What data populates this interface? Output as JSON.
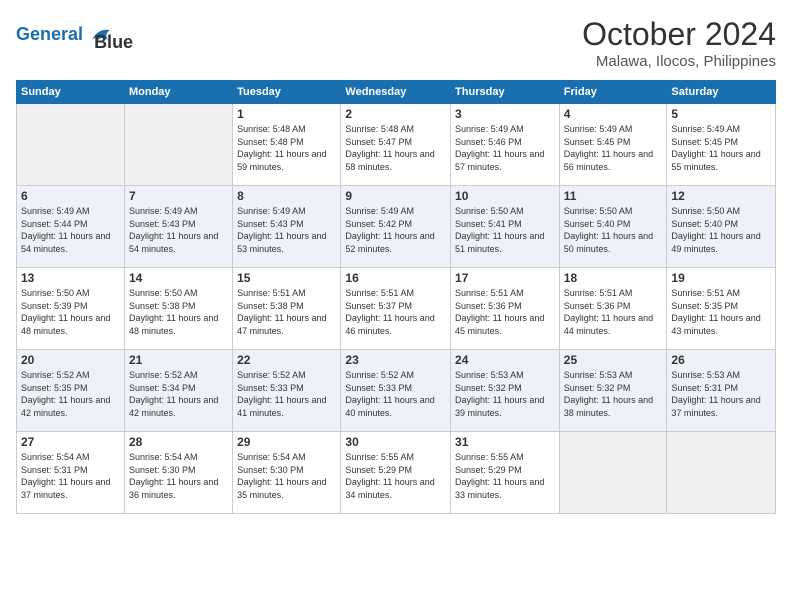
{
  "logo": {
    "line1": "General",
    "line2": "Blue"
  },
  "title": "October 2024",
  "location": "Malawa, Ilocos, Philippines",
  "weekdays": [
    "Sunday",
    "Monday",
    "Tuesday",
    "Wednesday",
    "Thursday",
    "Friday",
    "Saturday"
  ],
  "weeks": [
    [
      {
        "day": "",
        "empty": true
      },
      {
        "day": "",
        "empty": true
      },
      {
        "day": "1",
        "sunrise": "Sunrise: 5:48 AM",
        "sunset": "Sunset: 5:48 PM",
        "daylight": "Daylight: 11 hours and 59 minutes."
      },
      {
        "day": "2",
        "sunrise": "Sunrise: 5:48 AM",
        "sunset": "Sunset: 5:47 PM",
        "daylight": "Daylight: 11 hours and 58 minutes."
      },
      {
        "day": "3",
        "sunrise": "Sunrise: 5:49 AM",
        "sunset": "Sunset: 5:46 PM",
        "daylight": "Daylight: 11 hours and 57 minutes."
      },
      {
        "day": "4",
        "sunrise": "Sunrise: 5:49 AM",
        "sunset": "Sunset: 5:45 PM",
        "daylight": "Daylight: 11 hours and 56 minutes."
      },
      {
        "day": "5",
        "sunrise": "Sunrise: 5:49 AM",
        "sunset": "Sunset: 5:45 PM",
        "daylight": "Daylight: 11 hours and 55 minutes."
      }
    ],
    [
      {
        "day": "6",
        "sunrise": "Sunrise: 5:49 AM",
        "sunset": "Sunset: 5:44 PM",
        "daylight": "Daylight: 11 hours and 54 minutes."
      },
      {
        "day": "7",
        "sunrise": "Sunrise: 5:49 AM",
        "sunset": "Sunset: 5:43 PM",
        "daylight": "Daylight: 11 hours and 54 minutes."
      },
      {
        "day": "8",
        "sunrise": "Sunrise: 5:49 AM",
        "sunset": "Sunset: 5:43 PM",
        "daylight": "Daylight: 11 hours and 53 minutes."
      },
      {
        "day": "9",
        "sunrise": "Sunrise: 5:49 AM",
        "sunset": "Sunset: 5:42 PM",
        "daylight": "Daylight: 11 hours and 52 minutes."
      },
      {
        "day": "10",
        "sunrise": "Sunrise: 5:50 AM",
        "sunset": "Sunset: 5:41 PM",
        "daylight": "Daylight: 11 hours and 51 minutes."
      },
      {
        "day": "11",
        "sunrise": "Sunrise: 5:50 AM",
        "sunset": "Sunset: 5:40 PM",
        "daylight": "Daylight: 11 hours and 50 minutes."
      },
      {
        "day": "12",
        "sunrise": "Sunrise: 5:50 AM",
        "sunset": "Sunset: 5:40 PM",
        "daylight": "Daylight: 11 hours and 49 minutes."
      }
    ],
    [
      {
        "day": "13",
        "sunrise": "Sunrise: 5:50 AM",
        "sunset": "Sunset: 5:39 PM",
        "daylight": "Daylight: 11 hours and 48 minutes."
      },
      {
        "day": "14",
        "sunrise": "Sunrise: 5:50 AM",
        "sunset": "Sunset: 5:38 PM",
        "daylight": "Daylight: 11 hours and 48 minutes."
      },
      {
        "day": "15",
        "sunrise": "Sunrise: 5:51 AM",
        "sunset": "Sunset: 5:38 PM",
        "daylight": "Daylight: 11 hours and 47 minutes."
      },
      {
        "day": "16",
        "sunrise": "Sunrise: 5:51 AM",
        "sunset": "Sunset: 5:37 PM",
        "daylight": "Daylight: 11 hours and 46 minutes."
      },
      {
        "day": "17",
        "sunrise": "Sunrise: 5:51 AM",
        "sunset": "Sunset: 5:36 PM",
        "daylight": "Daylight: 11 hours and 45 minutes."
      },
      {
        "day": "18",
        "sunrise": "Sunrise: 5:51 AM",
        "sunset": "Sunset: 5:36 PM",
        "daylight": "Daylight: 11 hours and 44 minutes."
      },
      {
        "day": "19",
        "sunrise": "Sunrise: 5:51 AM",
        "sunset": "Sunset: 5:35 PM",
        "daylight": "Daylight: 11 hours and 43 minutes."
      }
    ],
    [
      {
        "day": "20",
        "sunrise": "Sunrise: 5:52 AM",
        "sunset": "Sunset: 5:35 PM",
        "daylight": "Daylight: 11 hours and 42 minutes."
      },
      {
        "day": "21",
        "sunrise": "Sunrise: 5:52 AM",
        "sunset": "Sunset: 5:34 PM",
        "daylight": "Daylight: 11 hours and 42 minutes."
      },
      {
        "day": "22",
        "sunrise": "Sunrise: 5:52 AM",
        "sunset": "Sunset: 5:33 PM",
        "daylight": "Daylight: 11 hours and 41 minutes."
      },
      {
        "day": "23",
        "sunrise": "Sunrise: 5:52 AM",
        "sunset": "Sunset: 5:33 PM",
        "daylight": "Daylight: 11 hours and 40 minutes."
      },
      {
        "day": "24",
        "sunrise": "Sunrise: 5:53 AM",
        "sunset": "Sunset: 5:32 PM",
        "daylight": "Daylight: 11 hours and 39 minutes."
      },
      {
        "day": "25",
        "sunrise": "Sunrise: 5:53 AM",
        "sunset": "Sunset: 5:32 PM",
        "daylight": "Daylight: 11 hours and 38 minutes."
      },
      {
        "day": "26",
        "sunrise": "Sunrise: 5:53 AM",
        "sunset": "Sunset: 5:31 PM",
        "daylight": "Daylight: 11 hours and 37 minutes."
      }
    ],
    [
      {
        "day": "27",
        "sunrise": "Sunrise: 5:54 AM",
        "sunset": "Sunset: 5:31 PM",
        "daylight": "Daylight: 11 hours and 37 minutes."
      },
      {
        "day": "28",
        "sunrise": "Sunrise: 5:54 AM",
        "sunset": "Sunset: 5:30 PM",
        "daylight": "Daylight: 11 hours and 36 minutes."
      },
      {
        "day": "29",
        "sunrise": "Sunrise: 5:54 AM",
        "sunset": "Sunset: 5:30 PM",
        "daylight": "Daylight: 11 hours and 35 minutes."
      },
      {
        "day": "30",
        "sunrise": "Sunrise: 5:55 AM",
        "sunset": "Sunset: 5:29 PM",
        "daylight": "Daylight: 11 hours and 34 minutes."
      },
      {
        "day": "31",
        "sunrise": "Sunrise: 5:55 AM",
        "sunset": "Sunset: 5:29 PM",
        "daylight": "Daylight: 11 hours and 33 minutes."
      },
      {
        "day": "",
        "empty": true
      },
      {
        "day": "",
        "empty": true
      }
    ]
  ]
}
